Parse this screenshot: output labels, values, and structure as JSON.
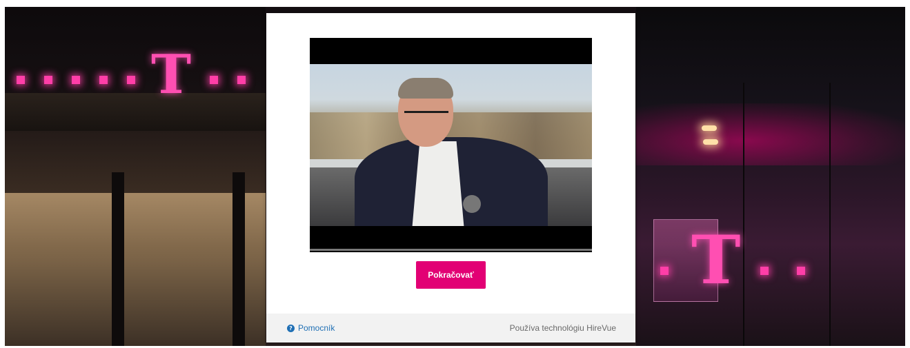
{
  "background": {
    "brand_letter": "T",
    "brand_color": "#e20074"
  },
  "video": {
    "progress_fraction": 0.0
  },
  "actions": {
    "continue_label": "Pokračovať"
  },
  "footer": {
    "help_label": "Pomocník",
    "help_icon": "question-circle-icon",
    "powered_by": "Používa technológiu HireVue"
  },
  "colors": {
    "accent": "#e20074",
    "link": "#1f6fb4",
    "footer_bg": "#f2f2f2"
  }
}
